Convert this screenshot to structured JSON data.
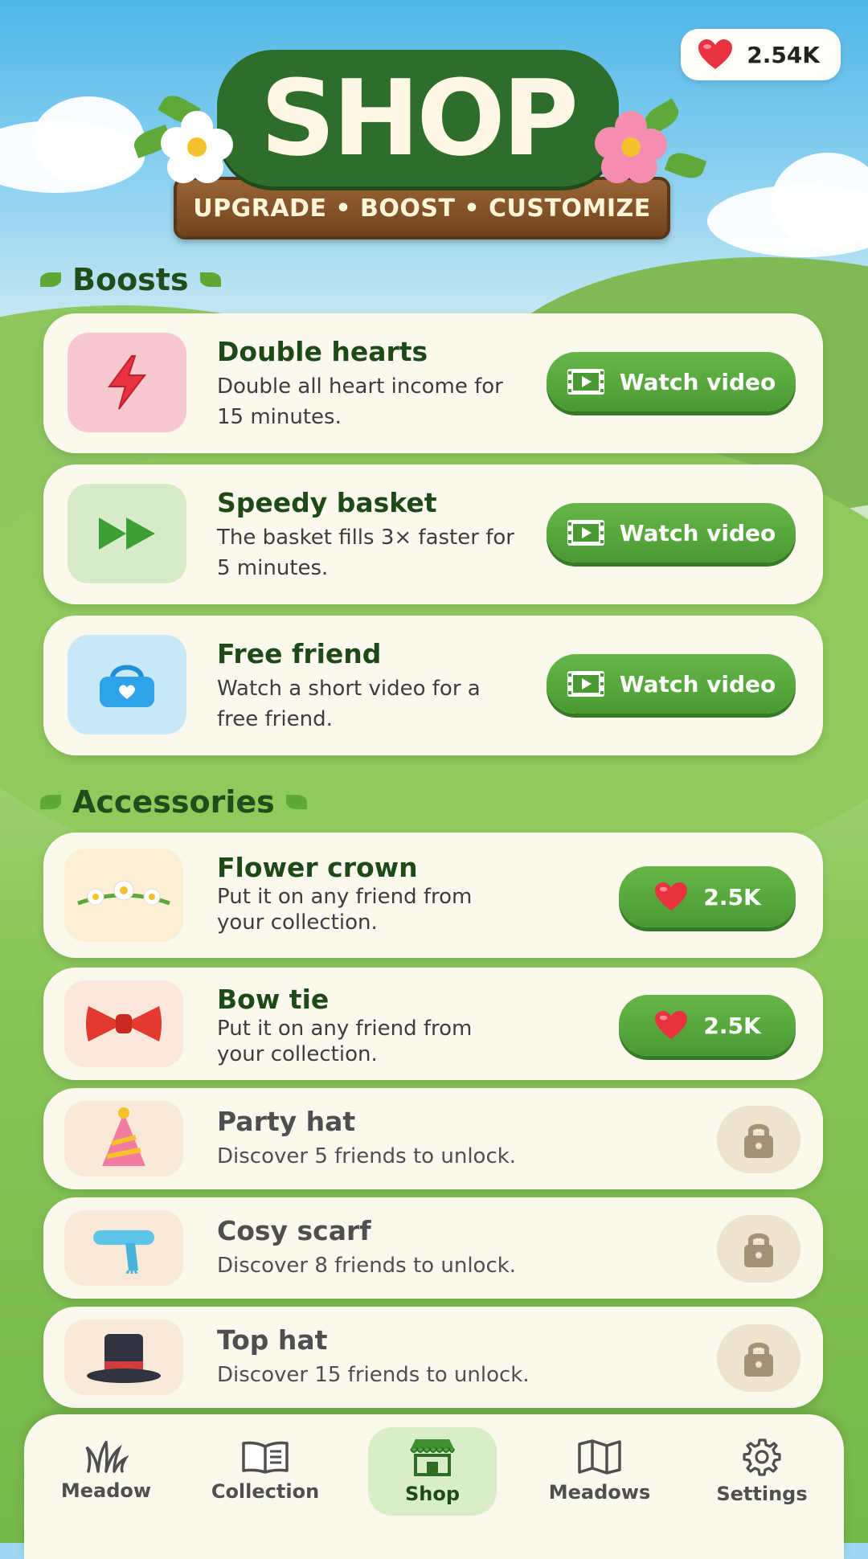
{
  "header": {
    "hearts_count": "2.54K",
    "title": "SHOP",
    "subtitle": "UPGRADE • BOOST • CUSTOMIZE"
  },
  "boosts": {
    "section_title": "Boosts",
    "items": [
      {
        "name": "Double hearts",
        "desc": "Double all heart income for 15 minutes.",
        "button": "Watch video",
        "icon": "lightning-icon"
      },
      {
        "name": "Speedy basket",
        "desc": "The basket fills 3× faster for 5 minutes.",
        "button": "Watch video",
        "icon": "fast-forward-icon"
      },
      {
        "name": "Free friend",
        "desc": "Watch a short video for a free friend.",
        "button": "Watch video",
        "icon": "basket-icon"
      }
    ]
  },
  "accessories": {
    "section_title": "Accessories",
    "items": [
      {
        "name": "Flower crown",
        "desc": "Put it on any friend from your collection.",
        "price": "2.5K",
        "locked": false,
        "icon": "flower-crown-icon"
      },
      {
        "name": "Bow tie",
        "desc": "Put it on any friend from your collection.",
        "price": "2.5K",
        "locked": false,
        "icon": "bow-tie-icon"
      },
      {
        "name": "Party hat",
        "desc": "Discover 5 friends to unlock.",
        "locked": true,
        "icon": "party-hat-icon"
      },
      {
        "name": "Cosy scarf",
        "desc": "Discover 8 friends to unlock.",
        "locked": true,
        "icon": "scarf-icon"
      },
      {
        "name": "Top hat",
        "desc": "Discover 15 friends to unlock.",
        "locked": true,
        "icon": "top-hat-icon"
      }
    ]
  },
  "nav": {
    "items": [
      {
        "label": "Meadow",
        "icon": "grass-icon"
      },
      {
        "label": "Collection",
        "icon": "book-icon"
      },
      {
        "label": "Shop",
        "icon": "shop-icon",
        "active": true
      },
      {
        "label": "Meadows",
        "icon": "map-icon"
      },
      {
        "label": "Settings",
        "icon": "gear-icon"
      }
    ]
  },
  "colors": {
    "accent_green": "#4a9a33",
    "title_green": "#1e4a1a",
    "heart_red": "#e8323f",
    "card_bg": "#fbf8ee"
  }
}
